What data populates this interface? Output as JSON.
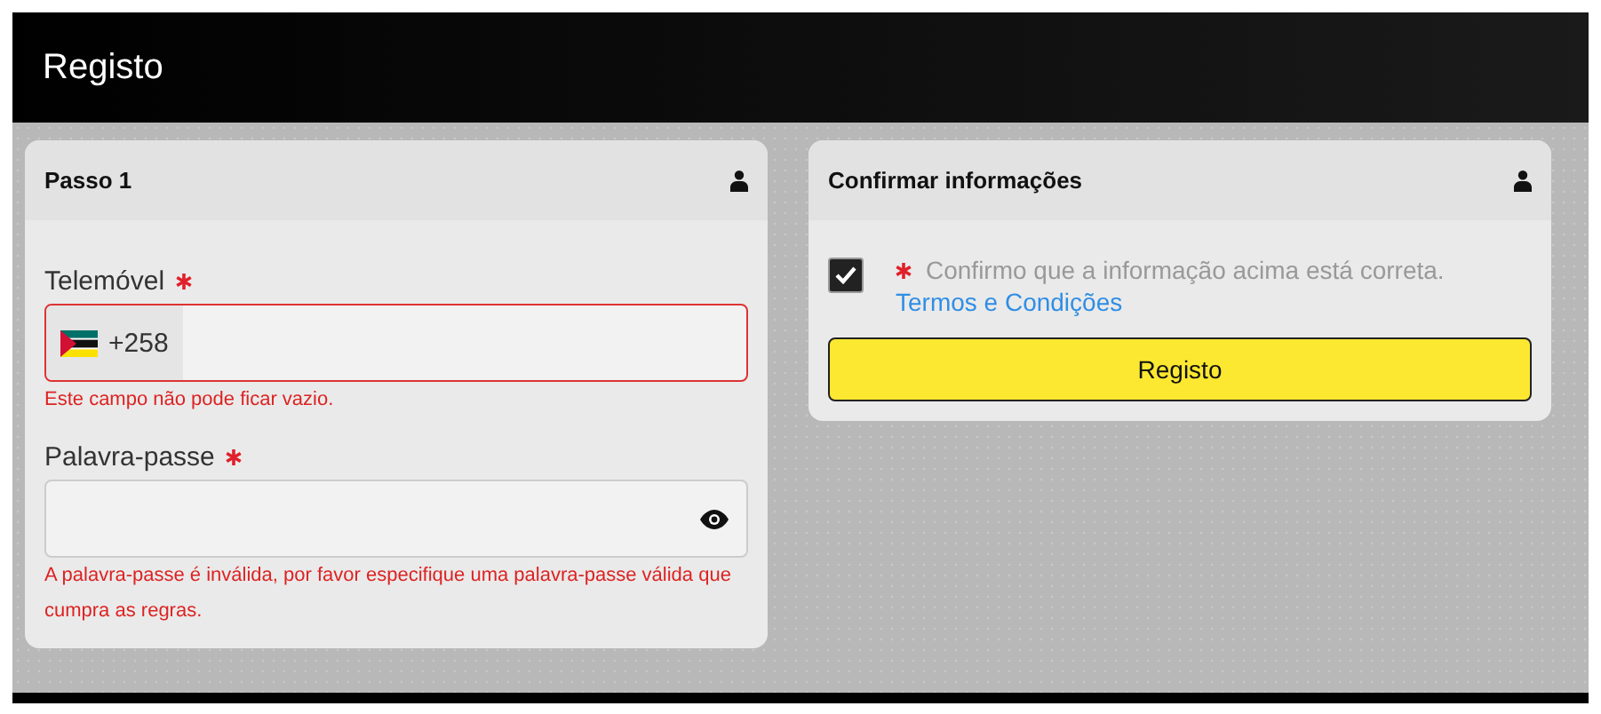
{
  "header": {
    "title": "Registo"
  },
  "step_card": {
    "title": "Passo 1",
    "fields": [
      {
        "kind": "phone",
        "label": "Telemóvel",
        "required": true,
        "prefix": "+258",
        "invalid": true,
        "error": "Este campo não pode ficar vazio."
      },
      {
        "kind": "password",
        "label": "Palavra-passe",
        "required": true,
        "invalid": false,
        "error": "A palavra-passe é inválida, por favor especifique uma palavra-passe válida que cumpra as regras."
      }
    ]
  },
  "confirm_card": {
    "title": "Confirmar informações",
    "checkbox": {
      "checked": true,
      "required": true,
      "label": "Confirmo que a informação acima está correta.",
      "link": "Termos e Condições"
    },
    "button": "Registo"
  }
}
